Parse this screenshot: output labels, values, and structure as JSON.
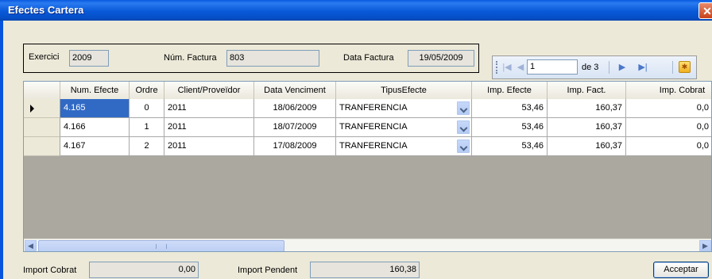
{
  "window": {
    "title": "Efectes Cartera",
    "close_glyph": "✕"
  },
  "header": {
    "exercici_label": "Exercici",
    "exercici_value": "2009",
    "factura_label": "Núm. Factura",
    "factura_value": "803",
    "data_label": "Data Factura",
    "data_value": "19/05/2009"
  },
  "navigator": {
    "position": "1",
    "count_label": "de 3"
  },
  "grid": {
    "columns": [
      "Num. Efecte",
      "Ordre",
      "Client/Proveïdor",
      "Data Venciment",
      "TipusEfecte",
      "Imp. Efecte",
      "Imp. Fact.",
      "Imp. Cobrat"
    ],
    "rows": [
      {
        "num": "4.165",
        "ordre": "0",
        "client": "2011",
        "data": "18/06/2009",
        "tipus": "TRANFERENCIA",
        "imp_efecte": "53,46",
        "imp_fact": "160,37",
        "imp_cobrat": "0,0"
      },
      {
        "num": "4.166",
        "ordre": "1",
        "client": "2011",
        "data": "18/07/2009",
        "tipus": "TRANFERENCIA",
        "imp_efecte": "53,46",
        "imp_fact": "160,37",
        "imp_cobrat": "0,0"
      },
      {
        "num": "4.167",
        "ordre": "2",
        "client": "2011",
        "data": "17/08/2009",
        "tipus": "TRANFERENCIA",
        "imp_efecte": "53,46",
        "imp_fact": "160,37",
        "imp_cobrat": "0,0"
      }
    ]
  },
  "footer": {
    "cobrat_label": "Import Cobrat",
    "cobrat_value": "0,00",
    "pendent_label": "Import Pendent",
    "pendent_value": "160,38",
    "accept_label": "Acceptar"
  }
}
